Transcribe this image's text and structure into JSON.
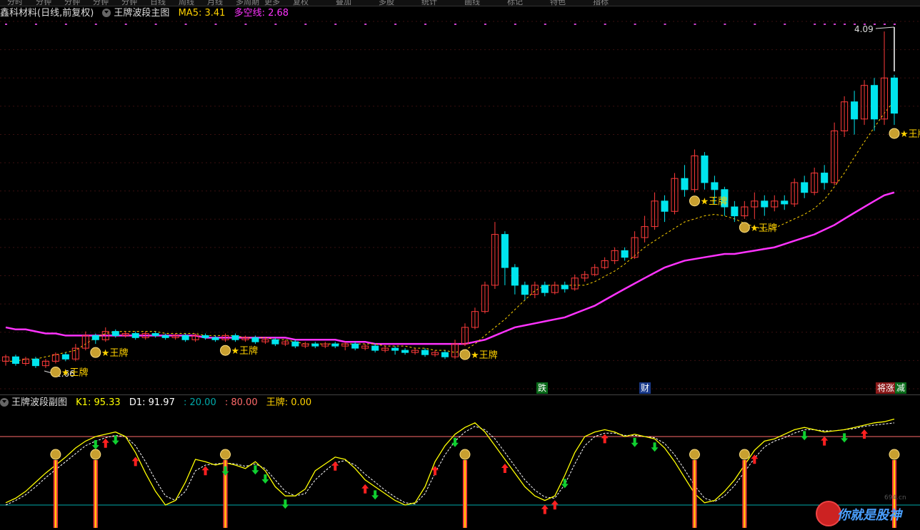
{
  "toolbar": {
    "items": [
      "分时",
      "分钟",
      "分钟",
      "分钟",
      "分钟",
      "日线",
      "周线",
      "月线",
      "多周期",
      "更多",
      "复权",
      "叠加",
      "多股",
      "统计",
      "画线",
      "标记",
      "特色",
      "指标"
    ]
  },
  "main_header": {
    "stock": "鑫科材料(日线,前复权)",
    "indicator": "王牌波段主图",
    "ma5": "MA5: 3.41",
    "duokong": "多空线: 2.68"
  },
  "sub_header": {
    "indicator": "王牌波段副图",
    "k1": "K1: 95.33",
    "d1": "D1: 91.97",
    "l20": ": 20.00",
    "l80": ": 80.00",
    "wangpai": "王牌: 0.00"
  },
  "signals": [
    {
      "label": "跌",
      "color": "#ffffff",
      "bg": "#0a6a1a"
    },
    {
      "label": "财",
      "color": "#ffffff",
      "bg": "#1a3a8a"
    },
    {
      "label": "将涨",
      "color": "#ffffff",
      "bg": "#8a1a1a"
    },
    {
      "label": "减",
      "color": "#ffffff",
      "bg": "#0a6a1a"
    }
  ],
  "watermark": {
    "text": "你就是股神",
    "url": "694.cn"
  },
  "colors": {
    "up": "#ff3b3b",
    "down": "#00e5ee",
    "ma5": "#ffd200",
    "duokong": "#ff33ff",
    "k1": "#ffff00",
    "d1": "#ffffff",
    "line20": "#00aaaa",
    "line80": "#ff6a6a",
    "wangpai": "#ffd200"
  },
  "chart_data": [
    {
      "type": "candlestick",
      "title": "王牌波段主图",
      "y_scale": "log",
      "ylim": [
        1.6,
        4.2
      ],
      "max_label": "4.09",
      "min_label": "1.66",
      "annotation_label": "王牌",
      "series": [
        {
          "name": "MA5",
          "values": [
            1.72,
            1.72,
            1.73,
            1.73,
            1.74,
            1.75,
            1.76,
            1.77,
            1.8,
            1.83,
            1.85,
            1.86,
            1.86,
            1.86,
            1.86,
            1.86,
            1.85,
            1.85,
            1.85,
            1.85,
            1.84,
            1.84,
            1.84,
            1.84,
            1.83,
            1.83,
            1.83,
            1.82,
            1.82,
            1.81,
            1.8,
            1.8,
            1.8,
            1.8,
            1.8,
            1.8,
            1.8,
            1.8,
            1.79,
            1.79,
            1.79,
            1.78,
            1.78,
            1.77,
            1.77,
            1.76,
            1.77,
            1.8,
            1.84,
            1.88,
            1.92,
            1.97,
            2.02,
            2.07,
            2.1,
            2.1,
            2.1,
            2.1,
            2.1,
            2.12,
            2.15,
            2.18,
            2.22,
            2.27,
            2.32,
            2.36,
            2.4,
            2.44,
            2.48,
            2.5,
            2.52,
            2.53,
            2.52,
            2.5,
            2.47,
            2.45,
            2.43,
            2.44,
            2.47,
            2.5,
            2.53,
            2.57,
            2.63,
            2.72,
            2.82,
            2.94,
            3.06,
            3.18,
            3.3,
            3.41
          ]
        },
        {
          "name": "多空线",
          "values": [
            1.88,
            1.87,
            1.87,
            1.86,
            1.85,
            1.85,
            1.84,
            1.84,
            1.84,
            1.84,
            1.84,
            1.84,
            1.84,
            1.84,
            1.84,
            1.84,
            1.84,
            1.84,
            1.84,
            1.84,
            1.83,
            1.83,
            1.83,
            1.83,
            1.83,
            1.83,
            1.83,
            1.83,
            1.83,
            1.82,
            1.82,
            1.82,
            1.82,
            1.82,
            1.81,
            1.81,
            1.81,
            1.8,
            1.8,
            1.8,
            1.8,
            1.8,
            1.8,
            1.8,
            1.8,
            1.8,
            1.8,
            1.81,
            1.82,
            1.84,
            1.86,
            1.88,
            1.89,
            1.9,
            1.91,
            1.92,
            1.93,
            1.95,
            1.97,
            1.99,
            2.02,
            2.05,
            2.08,
            2.11,
            2.14,
            2.17,
            2.2,
            2.22,
            2.24,
            2.25,
            2.26,
            2.27,
            2.28,
            2.28,
            2.29,
            2.3,
            2.31,
            2.32,
            2.34,
            2.36,
            2.38,
            2.4,
            2.43,
            2.46,
            2.5,
            2.54,
            2.58,
            2.62,
            2.66,
            2.68
          ]
        }
      ],
      "candles": [
        [
          1.72,
          1.74,
          1.75,
          1.7
        ],
        [
          1.74,
          1.71,
          1.75,
          1.7
        ],
        [
          1.71,
          1.73,
          1.74,
          1.7
        ],
        [
          1.73,
          1.7,
          1.74,
          1.69
        ],
        [
          1.7,
          1.72,
          1.73,
          1.69
        ],
        [
          1.72,
          1.75,
          1.76,
          1.71
        ],
        [
          1.75,
          1.73,
          1.76,
          1.72
        ],
        [
          1.73,
          1.78,
          1.8,
          1.72
        ],
        [
          1.78,
          1.84,
          1.86,
          1.77
        ],
        [
          1.84,
          1.82,
          1.85,
          1.8
        ],
        [
          1.82,
          1.86,
          1.88,
          1.81
        ],
        [
          1.86,
          1.84,
          1.87,
          1.83
        ],
        [
          1.84,
          1.85,
          1.86,
          1.83
        ],
        [
          1.85,
          1.83,
          1.86,
          1.82
        ],
        [
          1.83,
          1.85,
          1.86,
          1.82
        ],
        [
          1.85,
          1.84,
          1.86,
          1.83
        ],
        [
          1.84,
          1.83,
          1.85,
          1.82
        ],
        [
          1.83,
          1.84,
          1.85,
          1.82
        ],
        [
          1.84,
          1.82,
          1.85,
          1.81
        ],
        [
          1.82,
          1.84,
          1.85,
          1.81
        ],
        [
          1.84,
          1.83,
          1.85,
          1.82
        ],
        [
          1.83,
          1.82,
          1.84,
          1.81
        ],
        [
          1.82,
          1.84,
          1.85,
          1.81
        ],
        [
          1.84,
          1.82,
          1.85,
          1.81
        ],
        [
          1.82,
          1.83,
          1.84,
          1.81
        ],
        [
          1.83,
          1.81,
          1.84,
          1.8
        ],
        [
          1.81,
          1.82,
          1.83,
          1.8
        ],
        [
          1.82,
          1.8,
          1.83,
          1.79
        ],
        [
          1.8,
          1.81,
          1.82,
          1.79
        ],
        [
          1.81,
          1.79,
          1.82,
          1.78
        ],
        [
          1.79,
          1.8,
          1.81,
          1.78
        ],
        [
          1.8,
          1.79,
          1.81,
          1.78
        ],
        [
          1.79,
          1.8,
          1.81,
          1.78
        ],
        [
          1.8,
          1.79,
          1.81,
          1.78
        ],
        [
          1.79,
          1.8,
          1.81,
          1.77
        ],
        [
          1.8,
          1.78,
          1.81,
          1.77
        ],
        [
          1.78,
          1.79,
          1.8,
          1.77
        ],
        [
          1.79,
          1.77,
          1.8,
          1.76
        ],
        [
          1.77,
          1.78,
          1.79,
          1.76
        ],
        [
          1.78,
          1.77,
          1.79,
          1.75
        ],
        [
          1.77,
          1.76,
          1.78,
          1.75
        ],
        [
          1.76,
          1.77,
          1.78,
          1.75
        ],
        [
          1.77,
          1.75,
          1.78,
          1.74
        ],
        [
          1.75,
          1.76,
          1.77,
          1.74
        ],
        [
          1.76,
          1.74,
          1.77,
          1.73
        ],
        [
          1.74,
          1.8,
          1.82,
          1.73
        ],
        [
          1.8,
          1.88,
          1.9,
          1.79
        ],
        [
          1.88,
          1.96,
          1.98,
          1.87
        ],
        [
          1.96,
          2.1,
          2.12,
          1.95
        ],
        [
          2.1,
          2.4,
          2.48,
          2.08
        ],
        [
          2.4,
          2.2,
          2.42,
          2.1
        ],
        [
          2.2,
          2.1,
          2.22,
          2.05
        ],
        [
          2.1,
          2.05,
          2.12,
          2.02
        ],
        [
          2.05,
          2.1,
          2.12,
          2.03
        ],
        [
          2.1,
          2.06,
          2.12,
          2.04
        ],
        [
          2.06,
          2.1,
          2.12,
          2.05
        ],
        [
          2.1,
          2.08,
          2.12,
          2.06
        ],
        [
          2.08,
          2.14,
          2.16,
          2.07
        ],
        [
          2.14,
          2.16,
          2.18,
          2.12
        ],
        [
          2.16,
          2.2,
          2.22,
          2.15
        ],
        [
          2.2,
          2.24,
          2.26,
          2.19
        ],
        [
          2.24,
          2.3,
          2.32,
          2.22
        ],
        [
          2.3,
          2.26,
          2.32,
          2.24
        ],
        [
          2.26,
          2.38,
          2.42,
          2.25
        ],
        [
          2.38,
          2.45,
          2.52,
          2.35
        ],
        [
          2.45,
          2.62,
          2.68,
          2.43
        ],
        [
          2.62,
          2.55,
          2.66,
          2.48
        ],
        [
          2.55,
          2.78,
          2.82,
          2.53
        ],
        [
          2.78,
          2.7,
          2.88,
          2.65
        ],
        [
          2.7,
          2.95,
          3.0,
          2.68
        ],
        [
          2.95,
          2.75,
          2.98,
          2.7
        ],
        [
          2.75,
          2.7,
          2.8,
          2.6
        ],
        [
          2.7,
          2.58,
          2.72,
          2.52
        ],
        [
          2.58,
          2.52,
          2.62,
          2.48
        ],
        [
          2.52,
          2.58,
          2.62,
          2.5
        ],
        [
          2.58,
          2.62,
          2.68,
          2.5
        ],
        [
          2.62,
          2.58,
          2.66,
          2.52
        ],
        [
          2.58,
          2.62,
          2.66,
          2.55
        ],
        [
          2.62,
          2.6,
          2.66,
          2.56
        ],
        [
          2.6,
          2.75,
          2.78,
          2.58
        ],
        [
          2.75,
          2.68,
          2.8,
          2.64
        ],
        [
          2.68,
          2.82,
          2.86,
          2.66
        ],
        [
          2.82,
          2.75,
          2.88,
          2.7
        ],
        [
          2.75,
          3.15,
          3.22,
          2.73
        ],
        [
          3.15,
          3.4,
          3.45,
          3.1
        ],
        [
          3.4,
          3.25,
          3.5,
          3.12
        ],
        [
          3.25,
          3.55,
          3.6,
          3.2
        ],
        [
          3.55,
          3.25,
          3.62,
          3.15
        ],
        [
          3.25,
          3.62,
          4.09,
          3.2
        ],
        [
          3.62,
          3.3,
          3.65,
          3.2
        ]
      ],
      "wangpai_marks": [
        5,
        9,
        22,
        46,
        69,
        74,
        89
      ]
    },
    {
      "type": "line",
      "title": "王牌波段副图",
      "ylim": [
        0,
        100
      ],
      "hlines": [
        20,
        80
      ],
      "series": [
        {
          "name": "K1",
          "values": [
            22,
            26,
            32,
            40,
            48,
            55,
            62,
            70,
            76,
            80,
            82,
            84,
            80,
            66,
            48,
            32,
            20,
            24,
            40,
            60,
            58,
            55,
            57,
            55,
            52,
            58,
            50,
            36,
            28,
            28,
            34,
            50,
            56,
            62,
            60,
            52,
            42,
            36,
            30,
            24,
            20,
            22,
            36,
            58,
            72,
            82,
            88,
            92,
            84,
            72,
            60,
            48,
            36,
            28,
            24,
            28,
            46,
            66,
            80,
            84,
            86,
            84,
            80,
            82,
            80,
            78,
            70,
            58,
            44,
            30,
            22,
            24,
            32,
            42,
            55,
            68,
            76,
            78,
            82,
            86,
            88,
            86,
            84,
            85,
            86,
            88,
            90,
            92,
            93,
            95.33
          ]
        },
        {
          "name": "D1",
          "values": [
            20,
            24,
            29,
            36,
            44,
            51,
            58,
            65,
            72,
            76,
            79,
            81,
            80,
            72,
            58,
            42,
            28,
            24,
            32,
            50,
            55,
            56,
            57,
            56,
            54,
            56,
            52,
            42,
            32,
            28,
            30,
            42,
            50,
            57,
            59,
            55,
            47,
            40,
            33,
            27,
            22,
            21,
            30,
            48,
            64,
            76,
            84,
            89,
            86,
            78,
            66,
            54,
            42,
            33,
            27,
            26,
            38,
            56,
            72,
            80,
            83,
            83,
            81,
            81,
            80,
            79,
            74,
            64,
            51,
            37,
            26,
            23,
            28,
            37,
            49,
            61,
            71,
            76,
            79,
            83,
            86,
            86,
            85,
            85,
            86,
            87,
            89,
            90,
            91,
            91.97
          ]
        }
      ],
      "arrows_up": [
        10,
        13,
        20,
        33,
        36,
        43,
        50,
        54,
        55,
        60,
        75,
        82,
        86
      ],
      "arrows_down": [
        9,
        11,
        22,
        25,
        26,
        28,
        37,
        45,
        56,
        63,
        65,
        80,
        84
      ],
      "wangpai_marks": [
        5,
        9,
        22,
        46,
        69,
        74,
        89
      ]
    }
  ]
}
